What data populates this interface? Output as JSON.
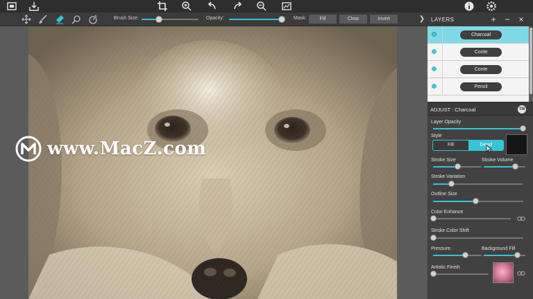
{
  "toolbar": {
    "brush_size_label": "Brush Size:",
    "brush_size_value": 0.3,
    "opacity_label": "Opacity:",
    "opacity_value": 0.95,
    "mask_label": "Mask:",
    "mask_buttons": [
      "Fill",
      "Clear",
      "Invert"
    ],
    "accent_color": "#37c3d8"
  },
  "top_icons": [
    "image-frame-icon",
    "save-tray-icon",
    "crop-icon",
    "zoom-in-icon",
    "undo-icon",
    "redo-icon",
    "zoom-out-icon",
    "compare-icon",
    "info-icon",
    "settings-icon"
  ],
  "tools": [
    "move-icon",
    "brush-icon",
    "eraser-icon",
    "wand-icon",
    "timer-icon"
  ],
  "watermark": {
    "text": "www.MacZ.com"
  },
  "layers": {
    "title": "LAYERS",
    "add": "+",
    "remove": "−",
    "close": "×",
    "items": [
      {
        "label": "Charcoal",
        "selected": true
      },
      {
        "label": "Conte",
        "selected": false
      },
      {
        "label": "Conte",
        "selected": false
      },
      {
        "label": "Pencil",
        "selected": false
      }
    ]
  },
  "adjust": {
    "title": "ADJUST : Charcoal",
    "badge": "TM",
    "layer_opacity": {
      "label": "Layer Opacity",
      "value": 0.99
    },
    "style": {
      "label": "Style",
      "options": [
        "Fill",
        "Detail"
      ],
      "selected": "Detail",
      "color": "#151515"
    },
    "stroke_size": {
      "label": "Stroke Size",
      "value": 0.5
    },
    "stroke_volume": {
      "label": "Stroke Volume",
      "value": 0.75
    },
    "stroke_variation": {
      "label": "Stroke Variation",
      "value": 0.2
    },
    "outline_size": {
      "label": "Outline Size",
      "value": 0.47
    },
    "color_enhance": {
      "label": "Color Enhance",
      "value": 0.0
    },
    "stroke_color_shift": {
      "label": "Stroke Color Shift",
      "value": 0.0
    },
    "pressure": {
      "label": "Pressure",
      "value": 0.65
    },
    "background_fill": {
      "label": "Background Fill",
      "value": 0.8
    },
    "artistic_finish": {
      "label": "Artistic Finish",
      "value": 0.0
    }
  }
}
